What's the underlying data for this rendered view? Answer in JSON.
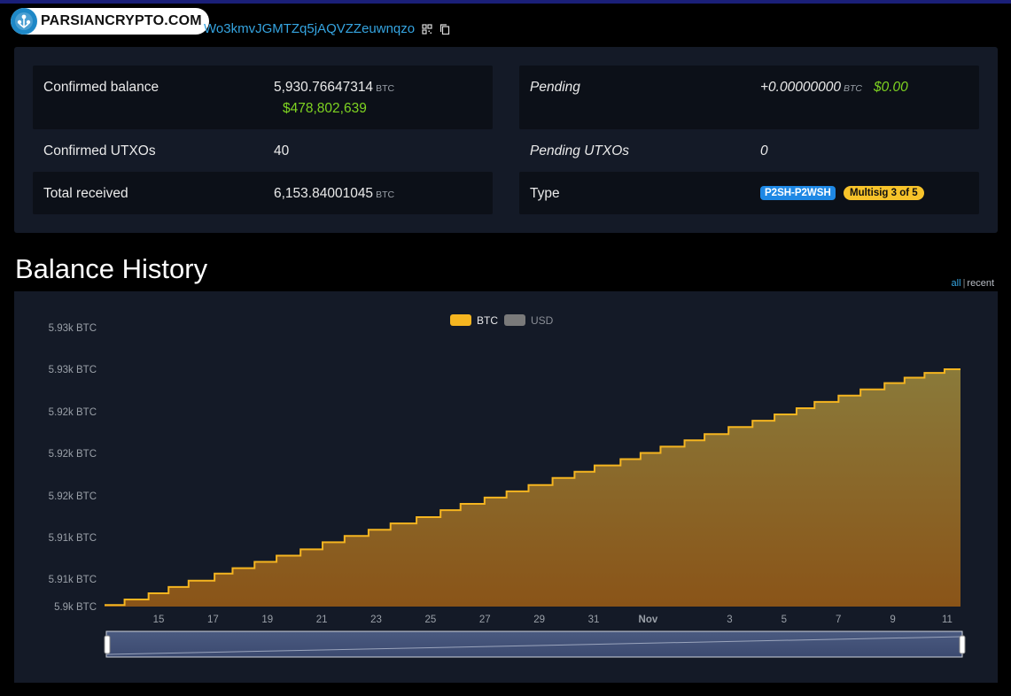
{
  "header": {
    "logo_text": "PARSIANCRYPTO.COM",
    "address": "Wo3kmvJGMTZq5jAQVZZeuwnqzo",
    "qr_icon": "qr-code-icon",
    "copy_icon": "copy-icon"
  },
  "summary": {
    "confirmed_balance_label": "Confirmed balance",
    "confirmed_balance_value": "5,930.76647314",
    "confirmed_balance_unit": "BTC",
    "confirmed_balance_usd": "$478,802,639",
    "confirmed_utxos_label": "Confirmed UTXOs",
    "confirmed_utxos_value": "40",
    "total_received_label": "Total received",
    "total_received_value": "6,153.84001045",
    "total_received_unit": "BTC",
    "pending_label": "Pending",
    "pending_value": "+0.00000000",
    "pending_unit": "BTC",
    "pending_usd": "$0.00",
    "pending_utxos_label": "Pending UTXOs",
    "pending_utxos_value": "0",
    "type_label": "Type",
    "type_badge_1": "P2SH-P2WSH",
    "type_badge_2": "Multisig 3 of 5"
  },
  "balance_history": {
    "title": "Balance History",
    "range_all": "all",
    "range_sep": "|",
    "range_recent": "recent"
  },
  "chart_data": {
    "type": "area",
    "x_ticks": [
      "15",
      "17",
      "19",
      "21",
      "23",
      "25",
      "27",
      "29",
      "31",
      "Nov",
      "3",
      "5",
      "7",
      "9",
      "11"
    ],
    "y_ticks": [
      "5.9k BTC",
      "5.91k BTC",
      "5.91k BTC",
      "5.92k BTC",
      "5.92k BTC",
      "5.92k BTC",
      "5.93k BTC",
      "5.93k BTC"
    ],
    "legend": [
      "BTC",
      "USD"
    ],
    "legend_active": "BTC",
    "colors": {
      "btc_line": "#f5b520",
      "btc_fill_top": "#8a7a3a",
      "btc_fill_bottom": "#8a5418",
      "usd": "#7a7a7a"
    },
    "series": [
      {
        "name": "BTC",
        "x_days_from_oct13": [
          0,
          1,
          2.2,
          3.2,
          4.2,
          5.5,
          6.4,
          7.5,
          8.6,
          9.8,
          10.9,
          12.0,
          13.2,
          14.3,
          15.6,
          16.8,
          17.8,
          19.0,
          20.1,
          21.2,
          22.4,
          23.5,
          24.5,
          25.8,
          26.8,
          27.8,
          29.0,
          30.0,
          31.2,
          32.4,
          33.5,
          34.6,
          35.5,
          36.7,
          37.8,
          39.0,
          40.0,
          41.0,
          42.0,
          42.8
        ],
        "values": [
          5900.7,
          5901.4,
          5902.2,
          5903.0,
          5903.8,
          5904.7,
          5905.4,
          5906.2,
          5907.0,
          5907.8,
          5908.7,
          5909.5,
          5910.3,
          5911.1,
          5911.9,
          5912.8,
          5913.6,
          5914.4,
          5915.2,
          5916.0,
          5916.9,
          5917.7,
          5918.5,
          5919.3,
          5920.1,
          5920.9,
          5921.7,
          5922.5,
          5923.4,
          5924.2,
          5925.0,
          5925.8,
          5926.6,
          5927.4,
          5928.2,
          5929.0,
          5929.7,
          5930.3,
          5930.77,
          5930.77
        ]
      }
    ],
    "ylim": [
      5900.7,
      5930.77
    ]
  }
}
